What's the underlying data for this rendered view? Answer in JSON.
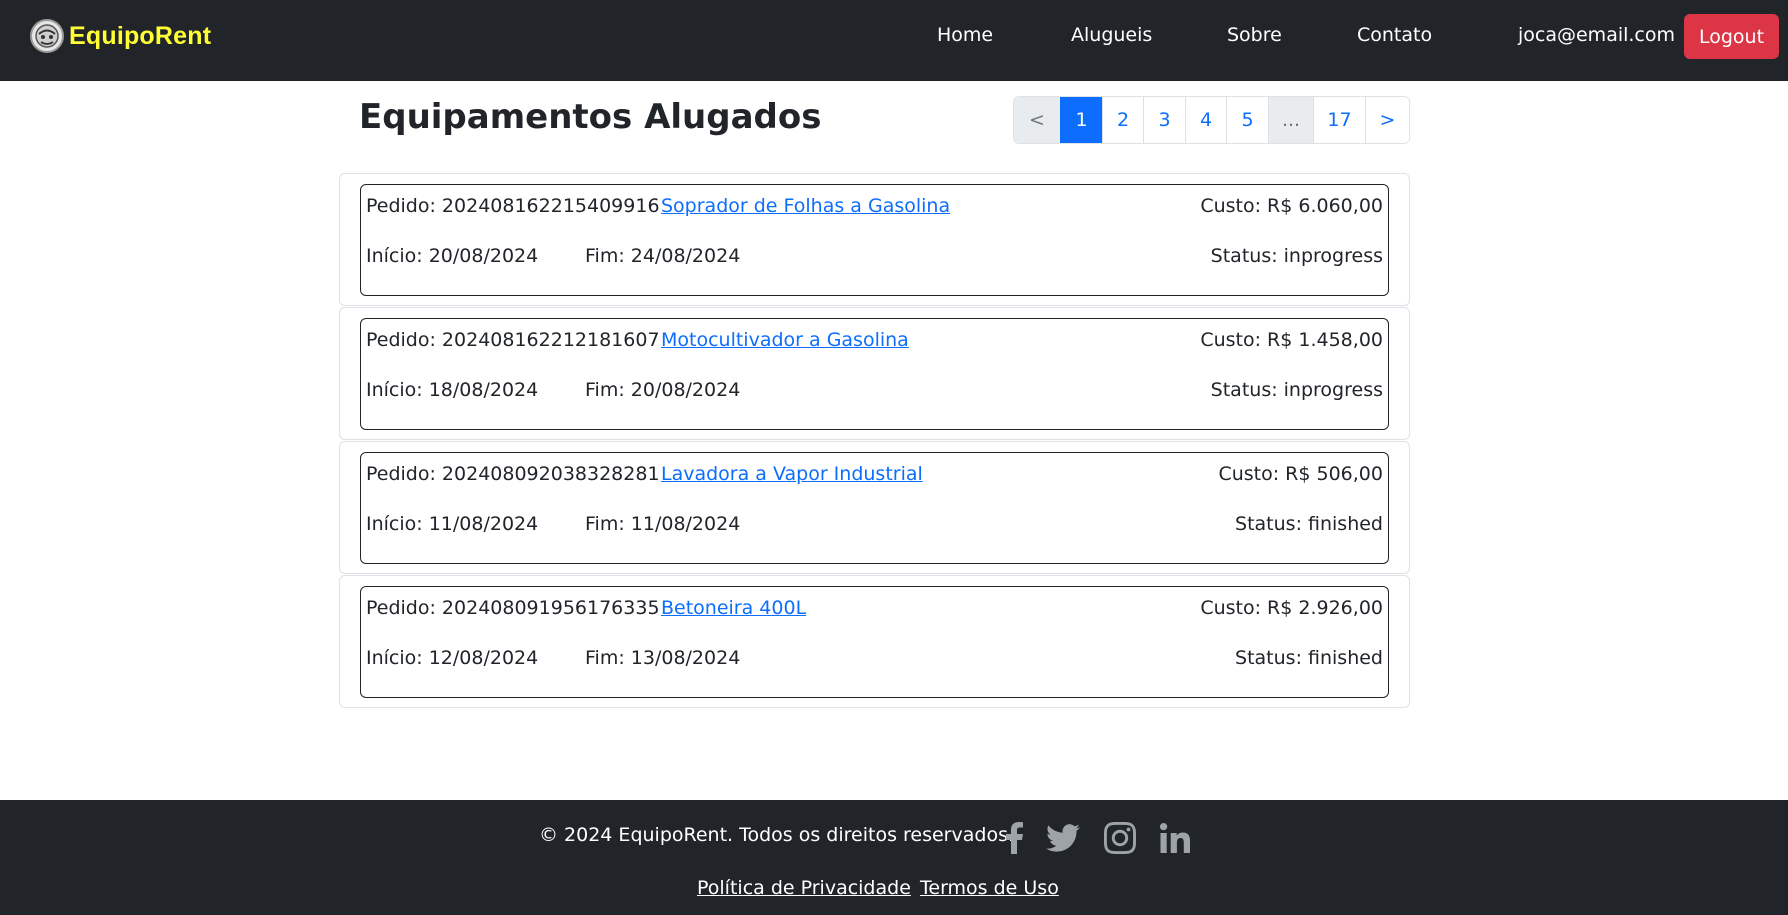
{
  "brand": {
    "name": "EquipoRent"
  },
  "nav": {
    "items": [
      {
        "label": "Home"
      },
      {
        "label": "Alugueis"
      },
      {
        "label": "Sobre"
      },
      {
        "label": "Contato"
      }
    ],
    "user_email": "joca@email.com",
    "logout_label": "Logout"
  },
  "page": {
    "title": "Equipamentos Alugados"
  },
  "pagination": {
    "items": [
      "<",
      "1",
      "2",
      "3",
      "4",
      "5",
      "...",
      "17",
      ">"
    ],
    "active": "1"
  },
  "rentals": [
    {
      "order": "Pedido: 202408162215409916",
      "item": "Soprador de Folhas a Gasolina",
      "cost": "Custo: R$ 6.060,00",
      "start": "Início: 20/08/2024",
      "end": "Fim: 24/08/2024",
      "status": "Status: inprogress"
    },
    {
      "order": "Pedido: 202408162212181607",
      "item": "Motocultivador a Gasolina",
      "cost": "Custo: R$ 1.458,00",
      "start": "Início: 18/08/2024",
      "end": "Fim: 20/08/2024",
      "status": "Status: inprogress"
    },
    {
      "order": "Pedido: 202408092038328281",
      "item": "Lavadora a Vapor Industrial",
      "cost": "Custo: R$ 506,00",
      "start": "Início: 11/08/2024",
      "end": "Fim: 11/08/2024",
      "status": "Status: finished"
    },
    {
      "order": "Pedido: 202408091956176335",
      "item": "Betoneira 400L",
      "cost": "Custo: R$ 2.926,00",
      "start": "Início: 12/08/2024",
      "end": "Fim: 13/08/2024",
      "status": "Status: finished"
    }
  ],
  "footer": {
    "copyright": "© 2024 EquipoRent. Todos os direitos reservados.",
    "social_icons": [
      "facebook-icon",
      "twitter-icon",
      "instagram-icon",
      "linkedin-icon"
    ],
    "links": [
      {
        "label": "Política de Privacidade"
      },
      {
        "label": "Termos de Uso"
      }
    ]
  },
  "colors": {
    "navbar_bg": "#212529",
    "brand_text": "#ffff33",
    "accent": "#0d6efd",
    "logout": "#dc3545"
  }
}
